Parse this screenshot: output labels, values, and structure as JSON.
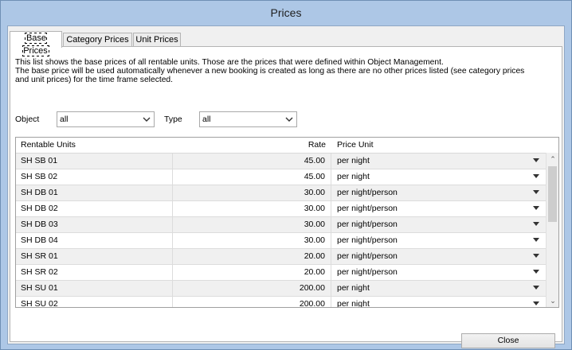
{
  "window": {
    "title": "Prices"
  },
  "tabs": [
    {
      "label": "Base Prices",
      "active": true
    },
    {
      "label": "Category Prices",
      "active": false
    },
    {
      "label": "Unit Prices",
      "active": false
    }
  ],
  "description": {
    "line1": "This list shows the base prices of all rentable units. Those are the prices that were defined within Object Management.",
    "line2": "The base price will be used automatically whenever a new booking is created as long as there are no other prices listed (see category prices",
    "line3": "and unit prices) for the time frame selected."
  },
  "filters": {
    "object_label": "Object",
    "object_value": "all",
    "type_label": "Type",
    "type_value": "all"
  },
  "grid": {
    "columns": [
      "Rentable Units",
      "Rate",
      "Price Unit"
    ],
    "rows": [
      {
        "unit": "SH SB 01",
        "rate": "45.00",
        "price_unit": "per night"
      },
      {
        "unit": "SH SB 02",
        "rate": "45.00",
        "price_unit": "per night"
      },
      {
        "unit": "SH DB 01",
        "rate": "30.00",
        "price_unit": "per night/person"
      },
      {
        "unit": "SH DB 02",
        "rate": "30.00",
        "price_unit": "per night/person"
      },
      {
        "unit": "SH DB 03",
        "rate": "30.00",
        "price_unit": "per night/person"
      },
      {
        "unit": "SH DB 04",
        "rate": "30.00",
        "price_unit": "per night/person"
      },
      {
        "unit": "SH SR 01",
        "rate": "20.00",
        "price_unit": "per night/person"
      },
      {
        "unit": "SH SR 02",
        "rate": "20.00",
        "price_unit": "per night/person"
      },
      {
        "unit": "SH SU 01",
        "rate": "200.00",
        "price_unit": "per night"
      },
      {
        "unit": "SH SU 02",
        "rate": "200.00",
        "price_unit": "per night"
      }
    ]
  },
  "buttons": {
    "close": "Close"
  }
}
